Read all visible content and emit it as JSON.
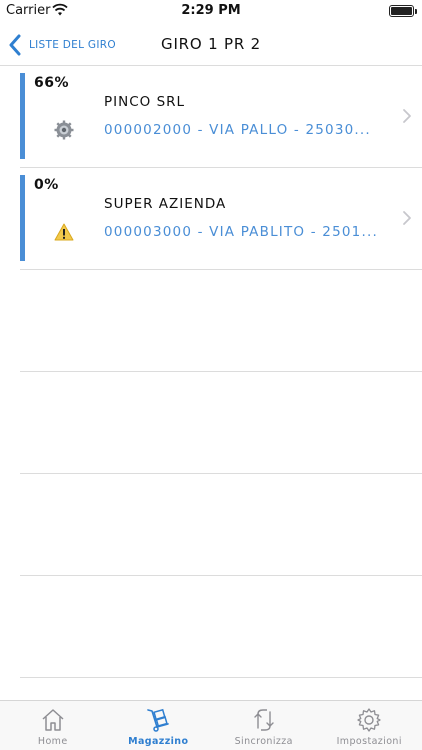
{
  "status_bar": {
    "carrier": "Carrier",
    "time": "2:29 PM"
  },
  "nav": {
    "back_label": "LISTE DEL GIRO",
    "title": "GIRO 1 PR 2"
  },
  "rows": [
    {
      "percent": "66%",
      "name": "PINCO SRL",
      "address": "000002000 - VIA PALLO - 25030...",
      "status_icon": "gear-icon"
    },
    {
      "percent": "0%",
      "name": "SUPER AZIENDA",
      "address": "000003000 - VIA PABLITO - 2501...",
      "status_icon": "warning-icon"
    }
  ],
  "tabs": [
    {
      "label": "Home",
      "icon": "home-icon",
      "active": false
    },
    {
      "label": "Magazzino",
      "icon": "hand-truck-icon",
      "active": true
    },
    {
      "label": "Sincronizza",
      "icon": "sync-icon",
      "active": false
    },
    {
      "label": "Impostazioni",
      "icon": "gear-icon",
      "active": false
    }
  ],
  "colors": {
    "accent": "#2f7fd0",
    "row_bar": "#4a8ed6",
    "warning": "#f2c94c"
  }
}
